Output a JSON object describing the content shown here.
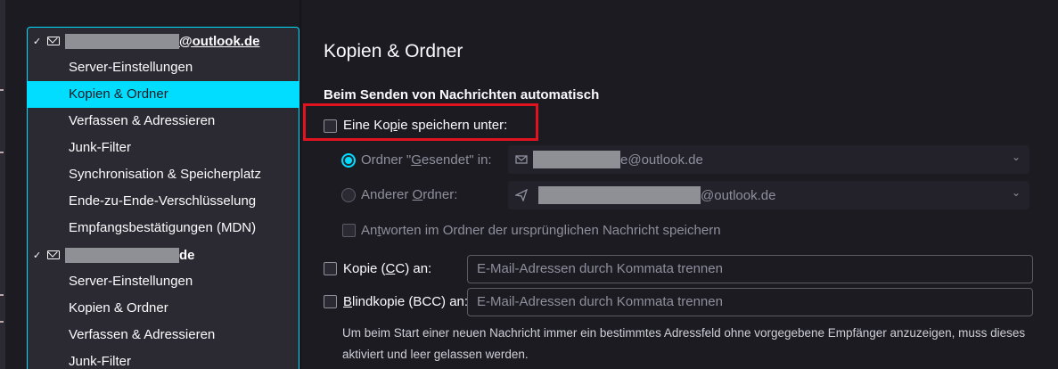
{
  "sidebar": {
    "accounts": [
      {
        "name_suffix": "@outlook.de",
        "items": [
          {
            "label": "Server-Einstellungen"
          },
          {
            "label": "Kopien & Ordner"
          },
          {
            "label": "Verfassen & Adressieren"
          },
          {
            "label": "Junk-Filter"
          },
          {
            "label": "Synchronisation & Speicherplatz"
          },
          {
            "label": "Ende-zu-Ende-Verschlüsselung"
          },
          {
            "label": "Empfangsbestätigungen (MDN)"
          }
        ]
      },
      {
        "name_suffix": "de",
        "items": [
          {
            "label": "Server-Einstellungen"
          },
          {
            "label": "Kopien & Ordner"
          },
          {
            "label": "Verfassen & Adressieren"
          },
          {
            "label": "Junk-Filter"
          }
        ]
      }
    ]
  },
  "main": {
    "title": "Kopien & Ordner",
    "section_title": "Beim Senden von Nachrichten automatisch",
    "save_copy": {
      "label_pre": "Eine Ko",
      "label_u": "p",
      "label_post": "ie speichern unter:",
      "checked": false
    },
    "sent_folder": {
      "label_pre": "Ordner \"",
      "label_u": "G",
      "label_post": "esendet\" in:",
      "selected": true,
      "value_suffix": "e@outlook.de"
    },
    "other_folder": {
      "label_pre": "Anderer ",
      "label_u": "O",
      "label_post": "rdner:",
      "selected": false,
      "value_suffix": "@outlook.de"
    },
    "reply_in_folder": {
      "label_pre": "An",
      "label_u": "t",
      "label_post": "worten im Ordner der ursprünglichen Nachricht speichern",
      "checked": false
    },
    "cc": {
      "label_pre": "Kopie (",
      "label_u": "C",
      "label_post": "C) an:",
      "placeholder": "E-Mail-Adressen durch Kommata trennen",
      "checked": false
    },
    "bcc": {
      "label_u": "B",
      "label_post": "lindkopie (BCC) an:",
      "placeholder": "E-Mail-Adressen durch Kommata trennen",
      "checked": false
    },
    "note": "Um beim Start einer neuen Nachricht immer ein bestimmtes Adressfeld ohne vorgegebene Empfänger anzuzeigen, muss dieses aktiviert und leer gelassen werden."
  },
  "colors": {
    "accent": "#00ddff",
    "highlight": "#e0141e",
    "bg": "#1c1b22",
    "panel": "#2b2a33"
  }
}
